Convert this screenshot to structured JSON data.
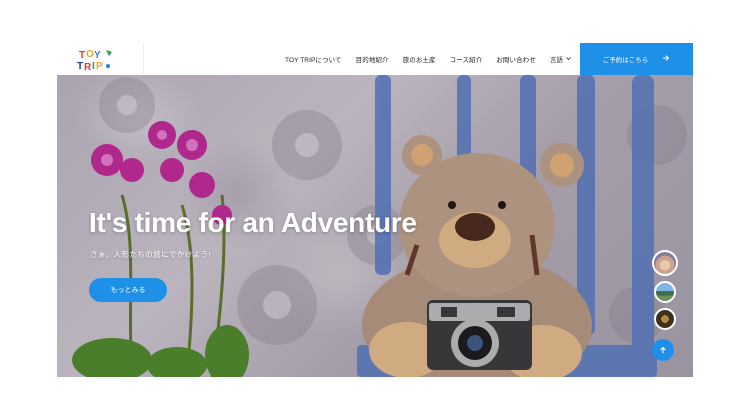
{
  "brand": {
    "logo_text": [
      "T",
      "O",
      "Y",
      "T",
      "R",
      "I",
      "P"
    ]
  },
  "nav": {
    "items": [
      {
        "label": "TOY TRIPについて"
      },
      {
        "label": "目的地紹介"
      },
      {
        "label": "旅のお土産"
      },
      {
        "label": "コース紹介"
      },
      {
        "label": "お問い合わせ"
      }
    ],
    "language_label": "言語"
  },
  "cta": {
    "label": "ご予約はこちら"
  },
  "hero": {
    "title": "It's time for an Adventure",
    "subtitle": "さぁ、人形たちの旅にでかけよう!",
    "button_label": "もっとみる"
  },
  "colors": {
    "accent": "#1e90e8",
    "white": "#ffffff"
  },
  "icons": {
    "cta_arrow": "arrow-right-icon",
    "lang_caret": "chevron-down-icon",
    "scroll": "arrow-up-icon"
  }
}
